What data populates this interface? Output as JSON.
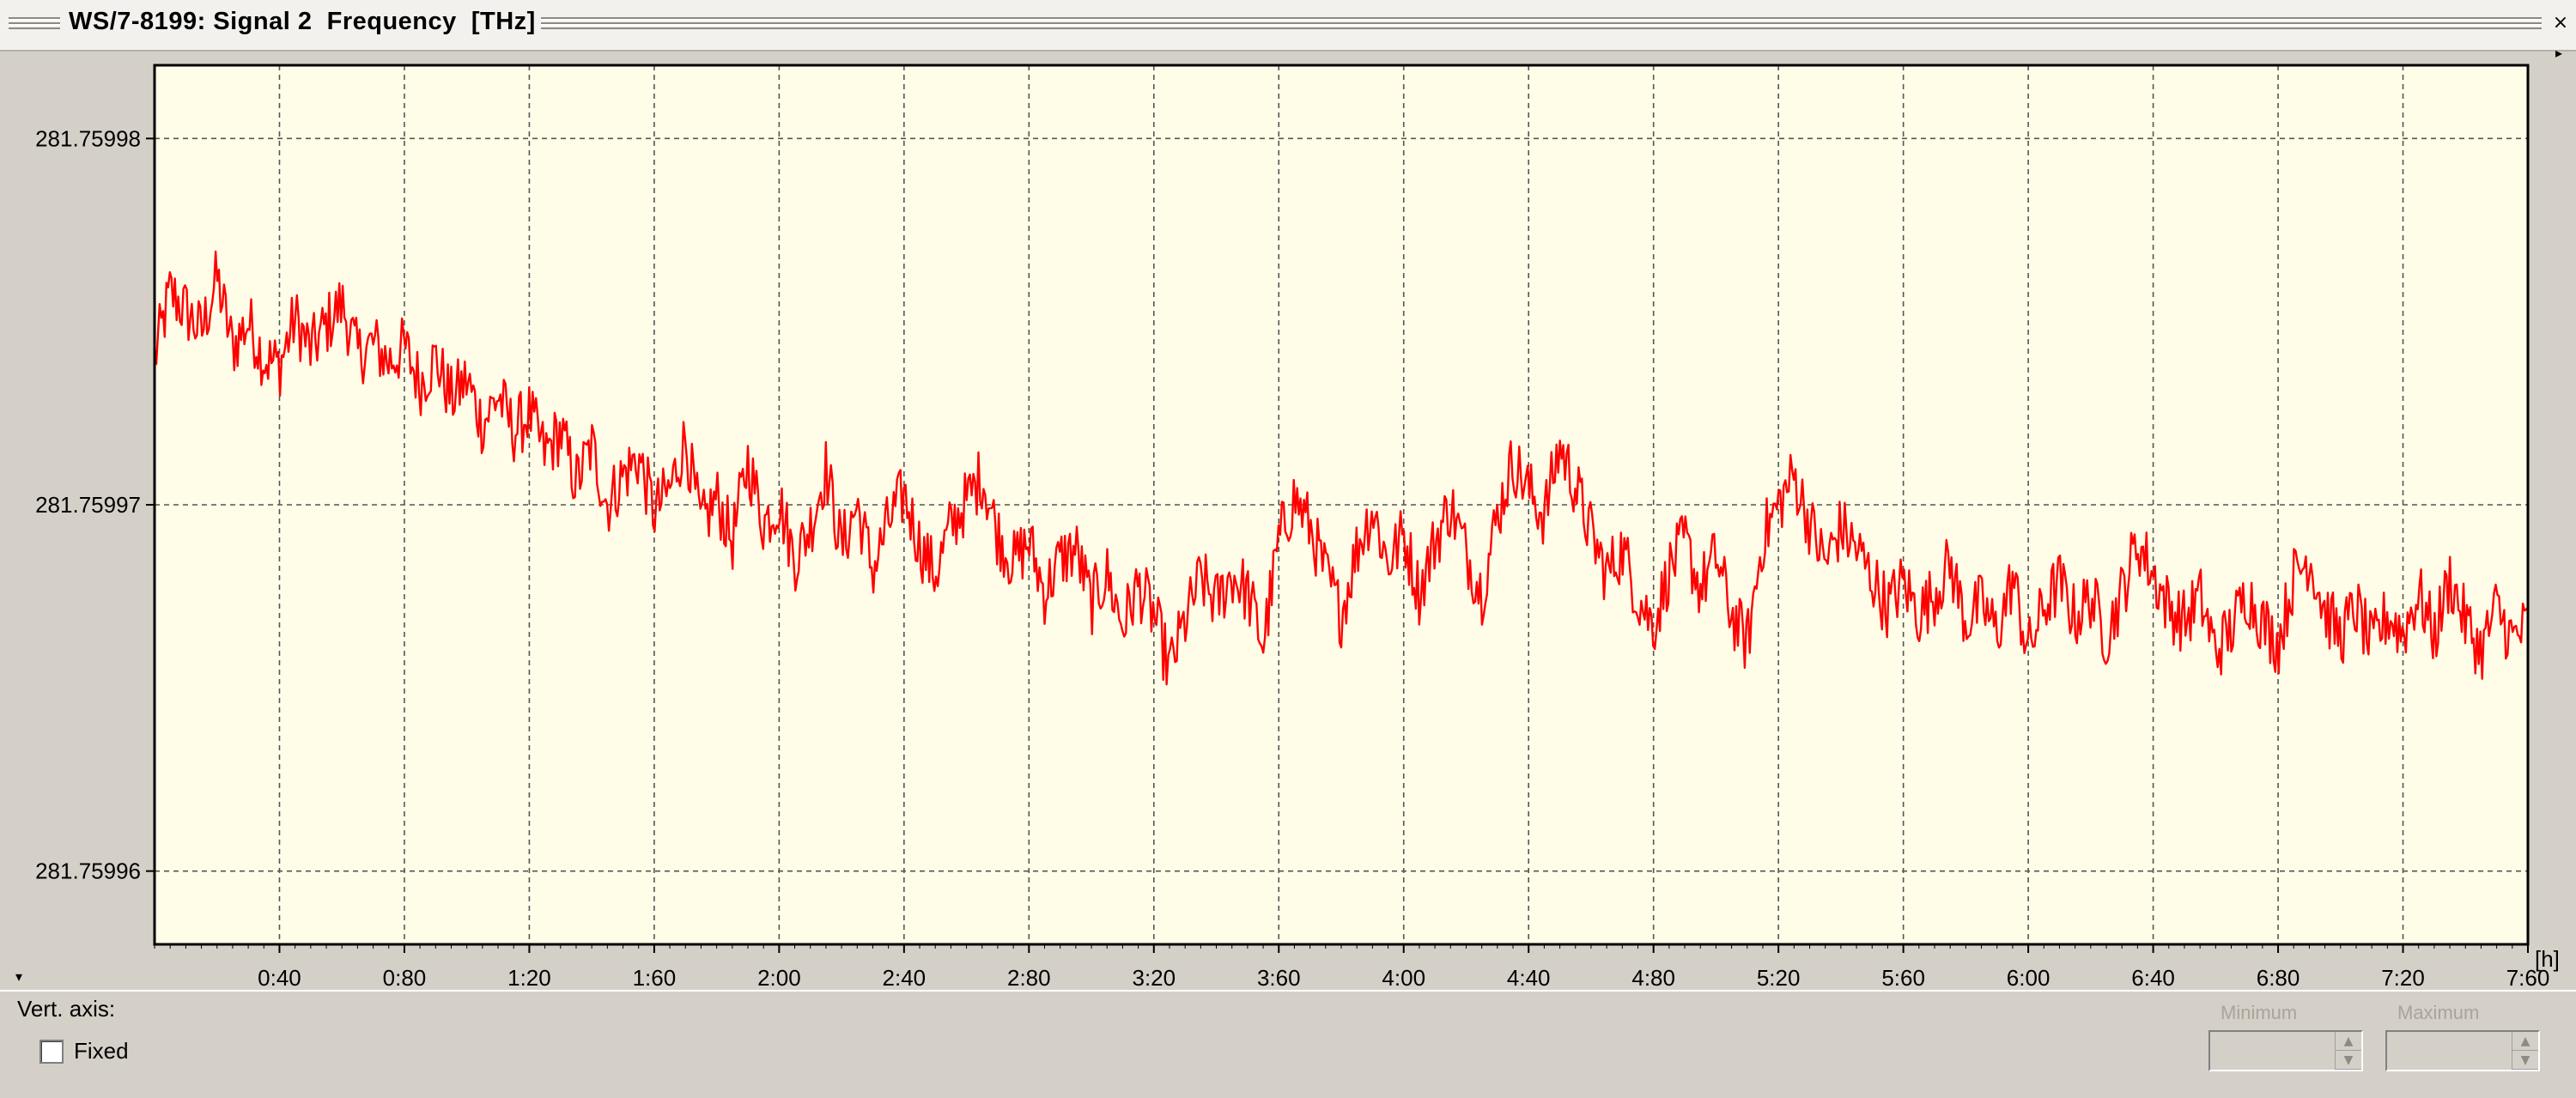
{
  "window": {
    "title": "WS/7-8199: Signal 2  Frequency  [THz]",
    "close_glyph": "×"
  },
  "chart_data": {
    "type": "line",
    "title": "WS/7-8199: Signal 2  Frequency  [THz]",
    "xlabel": "[h]",
    "ylabel": "",
    "xlim": [
      0,
      7.6
    ],
    "ylim": [
      281.759958,
      281.759982
    ],
    "y_ticks": [
      "281.75998",
      "281.75997",
      "281.75996"
    ],
    "y_tick_values": [
      281.75998,
      281.75997,
      281.75996
    ],
    "x_ticks": [
      "0:40",
      "0:80",
      "1:20",
      "1:60",
      "2:00",
      "2:40",
      "2:80",
      "3:20",
      "3:60",
      "4:00",
      "4:40",
      "4:80",
      "5:20",
      "5:60",
      "6:00",
      "6:40",
      "6:80",
      "7:20",
      "7:60"
    ],
    "x_tick_values": [
      0.4,
      0.8,
      1.2,
      1.6,
      2.0,
      2.4,
      2.8,
      3.2,
      3.6,
      4.0,
      4.4,
      4.8,
      5.2,
      5.6,
      6.0,
      6.4,
      6.8,
      7.2,
      7.6
    ],
    "grid": true,
    "background": "#fffde8",
    "series": [
      {
        "color": "#ff0000",
        "x": [
          0,
          0.05,
          0.1,
          0.15,
          0.2,
          0.25,
          0.3,
          0.35,
          0.4,
          0.45,
          0.5,
          0.55,
          0.6,
          0.65,
          0.7,
          0.75,
          0.8,
          0.85,
          0.9,
          0.95,
          1.0,
          1.05,
          1.1,
          1.15,
          1.2,
          1.25,
          1.3,
          1.35,
          1.4,
          1.45,
          1.5,
          1.55,
          1.6,
          1.65,
          1.7,
          1.75,
          1.8,
          1.85,
          1.9,
          1.95,
          2.0,
          2.05,
          2.1,
          2.15,
          2.2,
          2.25,
          2.3,
          2.35,
          2.4,
          2.45,
          2.5,
          2.55,
          2.6,
          2.65,
          2.7,
          2.75,
          2.8,
          2.85,
          2.9,
          2.95,
          3.0,
          3.05,
          3.1,
          3.15,
          3.2,
          3.25,
          3.3,
          3.35,
          3.4,
          3.45,
          3.5,
          3.55,
          3.6,
          3.65,
          3.7,
          3.75,
          3.8,
          3.85,
          3.9,
          3.95,
          4.0,
          4.05,
          4.1,
          4.15,
          4.2,
          4.25,
          4.3,
          4.35,
          4.4,
          4.45,
          4.5,
          4.55,
          4.6,
          4.65,
          4.7,
          4.75,
          4.8,
          4.85,
          4.9,
          4.95,
          5.0,
          5.05,
          5.1,
          5.15,
          5.2,
          5.25,
          5.3,
          5.35,
          5.4,
          5.45,
          5.5,
          5.55,
          5.6,
          5.65,
          5.7,
          5.75,
          5.8,
          5.85,
          5.9,
          5.95,
          6.0,
          6.05,
          6.1,
          6.15,
          6.2,
          6.25,
          6.3,
          6.35,
          6.4,
          6.45,
          6.5,
          6.55,
          6.6,
          6.65,
          6.7,
          6.75,
          6.8,
          6.85,
          6.9,
          6.95,
          7.0,
          7.05,
          7.1,
          7.15,
          7.2,
          7.25,
          7.3,
          7.35,
          7.4,
          7.45,
          7.5,
          7.55,
          7.6
        ],
        "y": [
          281.759974,
          281.7599758,
          281.7599753,
          281.7599747,
          281.7599762,
          281.7599743,
          281.759975,
          281.759974,
          281.7599738,
          281.7599751,
          281.7599742,
          281.7599749,
          281.7599755,
          281.7599741,
          281.7599744,
          281.7599739,
          281.7599743,
          281.7599733,
          281.759974,
          281.7599729,
          281.7599734,
          281.7599722,
          281.759973,
          281.759972,
          281.7599725,
          281.7599714,
          281.759972,
          281.7599706,
          281.7599716,
          281.75997,
          281.7599708,
          281.7599713,
          281.7599698,
          281.7599704,
          281.7599718,
          281.7599694,
          281.7599702,
          281.759969,
          281.7599712,
          281.7599695,
          281.7599701,
          281.7599685,
          281.7599694,
          281.759971,
          281.7599688,
          281.75997,
          281.7599682,
          281.7599695,
          281.7599703,
          281.7599689,
          281.7599681,
          281.7599694,
          281.7599701,
          281.7599708,
          281.7599692,
          281.7599684,
          281.759969,
          281.7599676,
          281.7599685,
          281.7599688,
          281.7599673,
          281.7599681,
          281.7599667,
          281.7599678,
          281.759967,
          281.7599655,
          281.7599668,
          281.759968,
          281.7599673,
          281.7599681,
          281.7599676,
          281.7599662,
          281.759969,
          281.7599702,
          281.7599694,
          281.7599681,
          281.759967,
          281.7599688,
          281.7599699,
          281.7599684,
          281.7599692,
          281.7599676,
          281.759969,
          281.75997,
          281.7599687,
          281.7599676,
          281.7599697,
          281.7599712,
          281.7599704,
          281.7599697,
          281.7599716,
          281.7599705,
          281.7599692,
          281.7599681,
          281.7599688,
          281.7599675,
          281.7599667,
          281.7599682,
          281.759969,
          281.7599677,
          281.7599686,
          281.759967,
          281.7599662,
          281.7599691,
          281.75997,
          281.7599708,
          281.7599695,
          281.7599684,
          281.7599694,
          281.7599688,
          281.759968,
          281.7599672,
          281.7599679,
          281.759967,
          281.7599676,
          281.7599684,
          281.7599668,
          281.7599673,
          281.7599665,
          281.759968,
          281.759966,
          281.7599672,
          281.7599679,
          281.7599669,
          281.7599675,
          281.7599664,
          281.7599676,
          281.759969,
          281.7599681,
          281.7599672,
          281.7599668,
          281.7599675,
          281.759966,
          281.7599666,
          281.7599676,
          281.7599668,
          281.7599662,
          281.759968,
          281.7599686,
          281.7599671,
          281.7599664,
          281.7599672,
          281.7599661,
          281.759967,
          281.7599665,
          281.7599676,
          281.7599664,
          281.759968,
          281.7599668,
          281.759966,
          281.7599672,
          281.7599663,
          281.7599667
        ]
      }
    ]
  },
  "bottom": {
    "vert_axis_label": "Vert. axis:",
    "fixed_label": "Fixed",
    "fixed_checked": false,
    "minimum_label": "Minimum",
    "maximum_label": "Maximum",
    "spin_up_glyph": "▲",
    "spin_down_glyph": "▼"
  }
}
